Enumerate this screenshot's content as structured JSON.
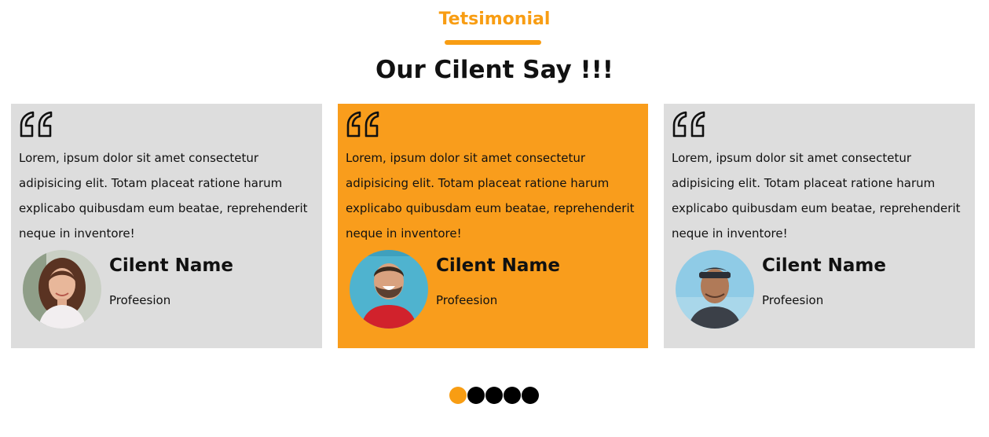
{
  "section": {
    "eyebrow": "Tetsimonial",
    "heading": "Our Cilent Say !!!"
  },
  "colors": {
    "accent": "#f89d13",
    "card_bg": "#dddddd",
    "card_active_bg": "#f99d1c",
    "text": "#111111"
  },
  "testimonials": [
    {
      "text": "Lorem, ipsum dolor sit amet consectetur adipisicing elit. Totam placeat ratione harum explicabo quibusdam eum beatae, reprehenderit neque in inventore!",
      "name": "Cilent Name",
      "profession": "Profeesion",
      "avatar_icon": "woman-portrait",
      "active": false
    },
    {
      "text": "Lorem, ipsum dolor sit amet consectetur adipisicing elit. Totam placeat ratione harum explicabo quibusdam eum beatae, reprehenderit neque in inventore!",
      "name": "Cilent Name",
      "profession": "Profeesion",
      "avatar_icon": "man-laughing-portrait",
      "active": true
    },
    {
      "text": "Lorem, ipsum dolor sit amet consectetur adipisicing elit. Totam placeat ratione harum explicabo quibusdam eum beatae, reprehenderit neque in inventore!",
      "name": "Cilent Name",
      "profession": "Profeesion",
      "avatar_icon": "man-cap-portrait",
      "active": false
    }
  ],
  "pagination": {
    "count": 5,
    "active_index": 0
  }
}
